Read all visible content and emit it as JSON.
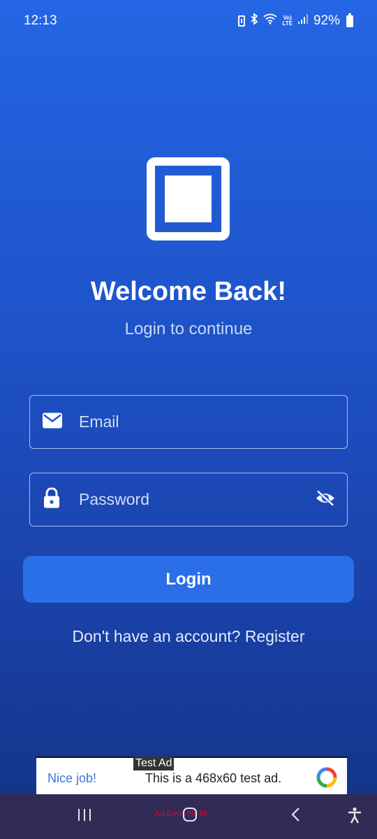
{
  "status_bar": {
    "time": "12:13",
    "volte": "Vo)\nLTE",
    "battery": "92%"
  },
  "header": {
    "logo": "square-logo-icon",
    "title": "Welcome Back!",
    "subtitle": "Login to continue"
  },
  "form": {
    "email_placeholder": "Email",
    "email_icon": "mail-icon",
    "password_placeholder": "Password",
    "password_icon": "lock-icon",
    "password_toggle_icon": "eye-off-icon",
    "login_label": "Login",
    "register_text": "Don't have an account? Register"
  },
  "ad": {
    "label": "Test Ad",
    "cta": "Nice job!",
    "text": "This is a 468x60 test ad.",
    "error_text": "Ad Error: No fill"
  },
  "colors": {
    "background_top": "#2466e4",
    "background_bottom": "#133283",
    "button": "#2a6ee8",
    "nav_bar": "#312b55"
  }
}
